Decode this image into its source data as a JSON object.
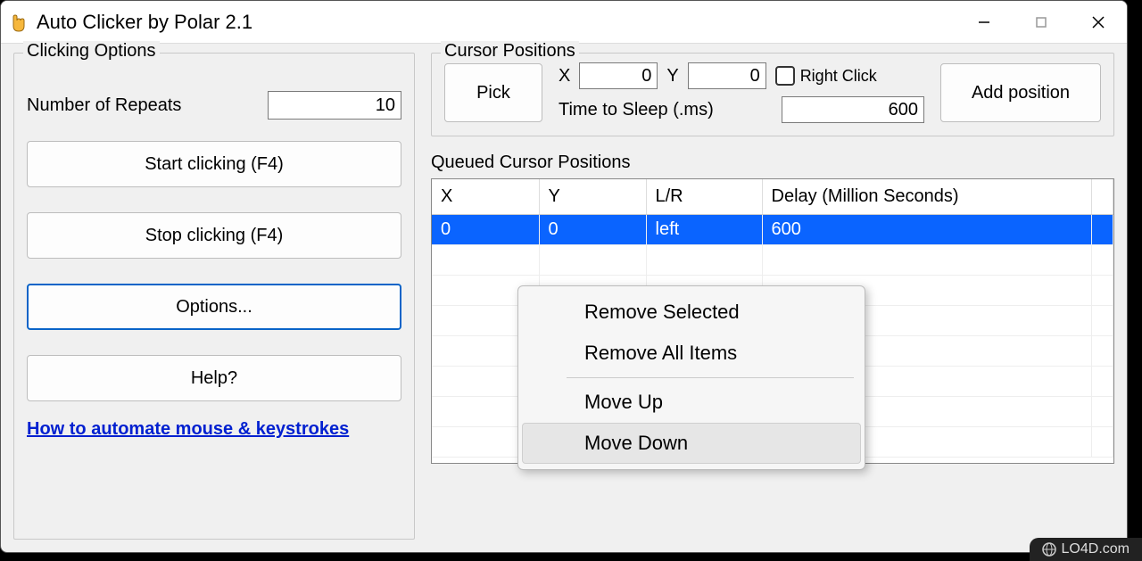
{
  "window": {
    "title": "Auto Clicker by Polar 2.1"
  },
  "clicking_options": {
    "legend": "Clicking Options",
    "repeats_label": "Number of Repeats",
    "repeats_value": "10",
    "start_label": "Start clicking (F4)",
    "stop_label": "Stop clicking (F4)",
    "options_label": "Options...",
    "help_label": "Help?",
    "link_label": "How to automate mouse & keystrokes"
  },
  "cursor_positions": {
    "legend": "Cursor Positions",
    "pick_label": "Pick",
    "x_label": "X",
    "x_value": "0",
    "y_label": "Y",
    "y_value": "0",
    "right_click_label": "Right Click",
    "sleep_label": "Time to Sleep (.ms)",
    "sleep_value": "600",
    "add_label": "Add position"
  },
  "queued": {
    "label": "Queued Cursor Positions",
    "headers": {
      "x": "X",
      "y": "Y",
      "lr": "L/R",
      "delay": "Delay (Million Seconds)"
    },
    "rows": [
      {
        "x": "0",
        "y": "0",
        "lr": "left",
        "delay": "600"
      }
    ]
  },
  "context_menu": {
    "remove_selected": "Remove Selected",
    "remove_all": "Remove All Items",
    "move_up": "Move Up",
    "move_down": "Move Down"
  },
  "watermark": "LO4D.com"
}
